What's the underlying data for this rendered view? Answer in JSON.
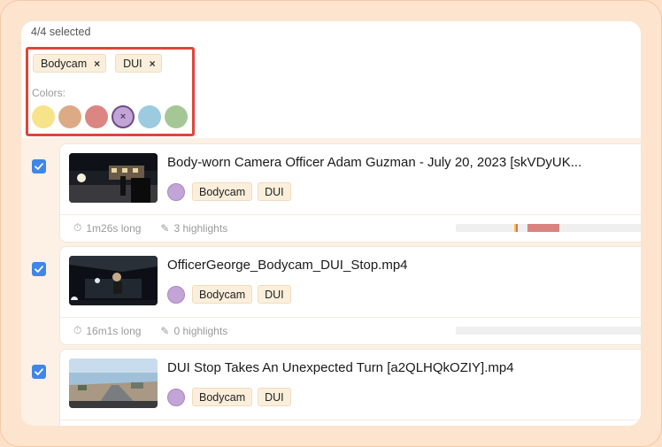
{
  "header": {
    "selected_count": "4/4 selected",
    "filter": {
      "tags": [
        {
          "label": "Bodycam",
          "remove": "×"
        },
        {
          "label": "DUI",
          "remove": "×"
        }
      ],
      "colors_label": "Colors:",
      "swatches": [
        {
          "name": "yellow",
          "color": "#f7e38a",
          "selected": false
        },
        {
          "name": "tan",
          "color": "#dcab85",
          "selected": false
        },
        {
          "name": "red",
          "color": "#db8682",
          "selected": false
        },
        {
          "name": "purple",
          "color": "#c3a4d6",
          "selected": true,
          "mark": "×"
        },
        {
          "name": "blue",
          "color": "#9ccbe0",
          "selected": false
        },
        {
          "name": "green",
          "color": "#a5c796",
          "selected": false
        }
      ]
    }
  },
  "videos": [
    {
      "checked": true,
      "title": "Body-worn Camera Officer Adam Guzman - July 20, 2023 [skVDyUK...",
      "tags": [
        "Bodycam",
        "DUI"
      ],
      "duration": "1m26s long",
      "highlights": "3 highlights",
      "timeline": [
        {
          "start": 0.295,
          "end": 0.305,
          "color": "#f2c84b"
        },
        {
          "start": 0.305,
          "end": 0.315,
          "color": "#d8735f"
        },
        {
          "start": 0.365,
          "end": 0.525,
          "color": "#d98380"
        }
      ]
    },
    {
      "checked": true,
      "title": "OfficerGeorge_Bodycam_DUI_Stop.mp4",
      "tags": [
        "Bodycam",
        "DUI"
      ],
      "duration": "16m1s long",
      "highlights": "0 highlights",
      "timeline": []
    },
    {
      "checked": true,
      "title": "DUI Stop Takes An Unexpected Turn [a2QLHQkOZIY].mp4",
      "tags": [
        "Bodycam",
        "DUI"
      ],
      "duration": "",
      "highlights": "",
      "timeline": []
    }
  ]
}
